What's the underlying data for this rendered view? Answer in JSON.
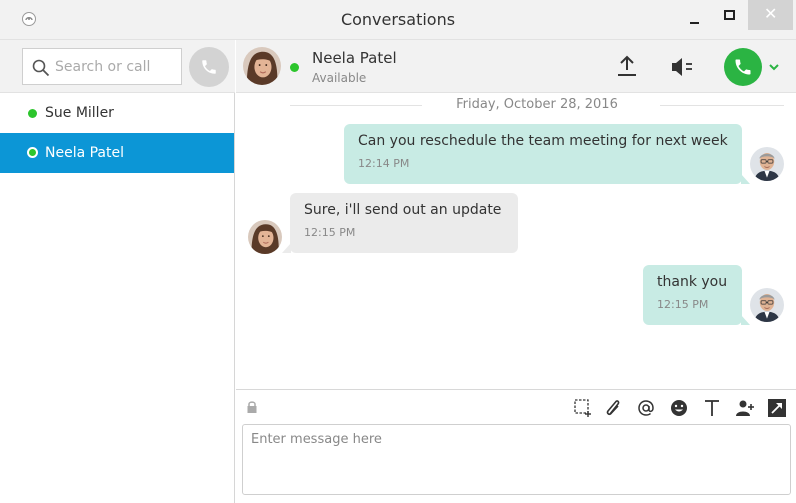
{
  "window": {
    "title": "Conversations",
    "close_glyph": "✕"
  },
  "sidebar": {
    "search_placeholder": "Search or call",
    "contacts": [
      {
        "name": "Sue Miller",
        "status_color": "#2cc52c",
        "selected": false
      },
      {
        "name": "Neela Patel",
        "status_color": "#2cc52c",
        "selected": true
      }
    ]
  },
  "header": {
    "contact_name": "Neela Patel",
    "contact_status": "Available"
  },
  "conversation": {
    "date": "Friday, October 28, 2016",
    "messages": [
      {
        "direction": "outgoing",
        "text": "Can you reschedule the team meeting for next week",
        "time": "12:14 PM"
      },
      {
        "direction": "incoming",
        "text": "Sure, i'll send out an update",
        "time": "12:15 PM"
      },
      {
        "direction": "outgoing",
        "text": "thank you",
        "time": "12:15 PM"
      }
    ]
  },
  "composer": {
    "placeholder": "Enter message here",
    "tools": [
      "screenshot-icon",
      "attach-icon",
      "mention-icon",
      "emoji-icon",
      "text-format-icon",
      "add-person-icon",
      "expand-icon"
    ]
  },
  "colors": {
    "accent": "#0c96d6",
    "call_green": "#2bb443",
    "outgoing_bubble": "#c8ebe4",
    "incoming_bubble": "#ebebeb"
  }
}
